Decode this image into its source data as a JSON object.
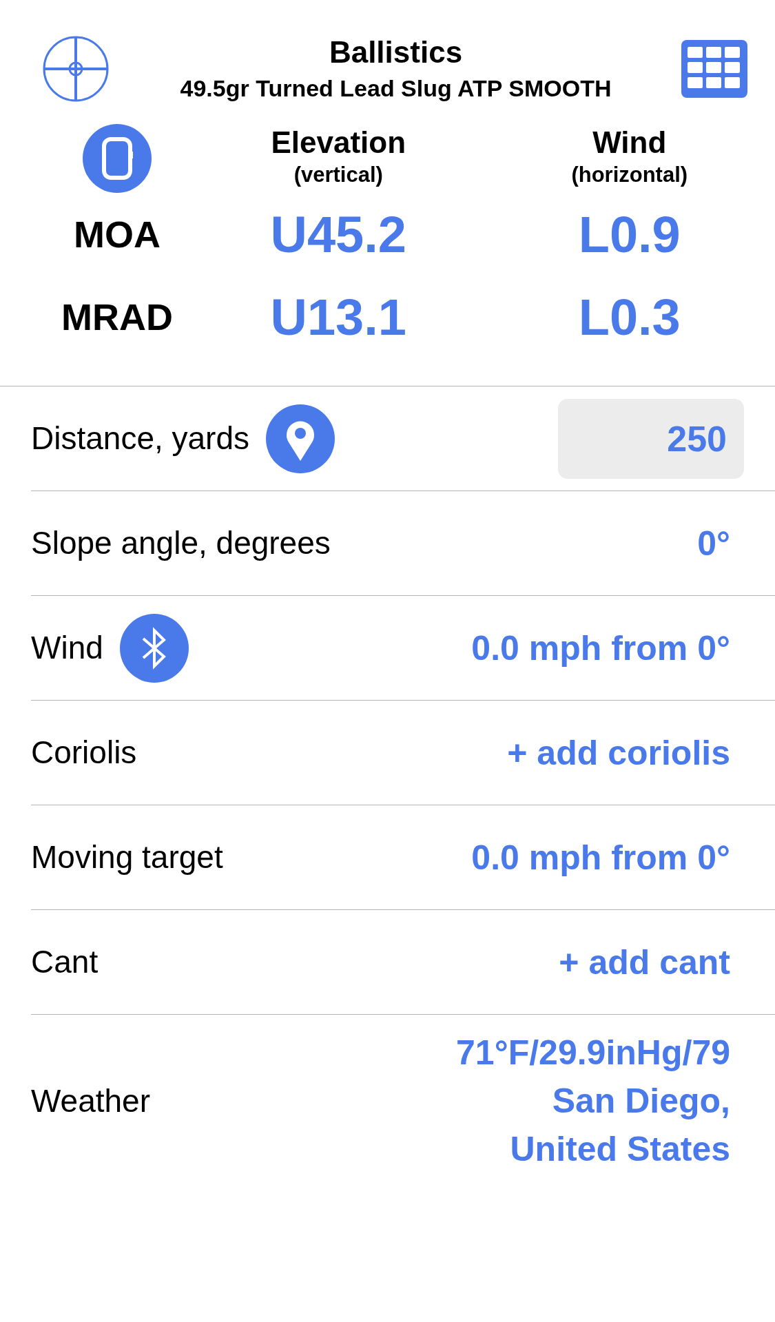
{
  "header": {
    "title": "Ballistics",
    "subtitle": "49.5gr Turned Lead Slug ATP SMOOTH"
  },
  "corrections": {
    "columns": [
      {
        "title": "Elevation",
        "note": "(vertical)"
      },
      {
        "title": "Wind",
        "note": "(horizontal)"
      }
    ],
    "rows": [
      {
        "unit": "MOA",
        "values": [
          "U45.2",
          "L0.9"
        ]
      },
      {
        "unit": "MRAD",
        "values": [
          "U13.1",
          "L0.3"
        ]
      }
    ]
  },
  "inputs": [
    {
      "kind": "field",
      "label": "Distance, yards",
      "value": "250"
    },
    {
      "kind": "plain",
      "label": "Slope angle, degrees",
      "value": "0°"
    },
    {
      "kind": "sensor",
      "label": "Wind",
      "value": "0.0 mph from 0°"
    },
    {
      "kind": "plain",
      "label": "Coriolis",
      "value": "+ add coriolis"
    },
    {
      "kind": "plain",
      "label": "Moving target",
      "value": "0.0 mph from 0°"
    },
    {
      "kind": "plain",
      "label": "Cant",
      "value": "+ add cant"
    },
    {
      "kind": "multiline",
      "label": "Weather",
      "lines": [
        "71°F/29.9inHg/79",
        "San Diego,",
        "United States"
      ]
    }
  ]
}
